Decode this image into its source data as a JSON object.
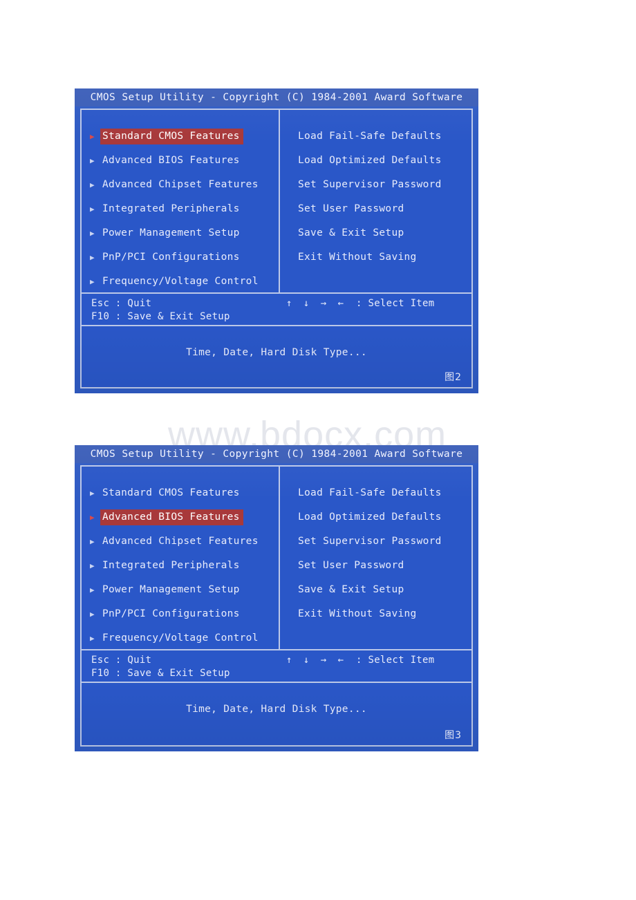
{
  "watermark": {
    "text": "www.bdocx.com"
  },
  "screens": [
    {
      "title": "CMOS Setup Utility - Copyright (C) 1984-2001 Award Software",
      "marker_icon": "right-triangle-icon",
      "left_menu": [
        {
          "label": "Standard CMOS Features",
          "selected": true
        },
        {
          "label": "Advanced BIOS Features",
          "selected": false
        },
        {
          "label": "Advanced Chipset Features",
          "selected": false
        },
        {
          "label": "Integrated Peripherals",
          "selected": false
        },
        {
          "label": "Power Management Setup",
          "selected": false
        },
        {
          "label": "PnP/PCI Configurations",
          "selected": false
        },
        {
          "label": "Frequency/Voltage Control",
          "selected": false
        }
      ],
      "right_menu": [
        {
          "label": "Load Fail-Safe Defaults"
        },
        {
          "label": "Load Optimized Defaults"
        },
        {
          "label": "Set Supervisor Password"
        },
        {
          "label": "Set User Password"
        },
        {
          "label": "Save & Exit Setup"
        },
        {
          "label": "Exit Without Saving"
        }
      ],
      "key_help": {
        "quit": "Esc : Quit",
        "save_exit": "F10 : Save & Exit Setup",
        "arrows": "↑ ↓ → ←",
        "select_item": ": Select Item"
      },
      "description": "Time, Date, Hard Disk Type...",
      "figure_caption": "图2",
      "colors": {
        "screen_blue": "#2a57c8",
        "title_blue": "#3a5db8",
        "frame_line": "#bcc8e8",
        "highlight_red": "#a8393b",
        "text_white": "#e8ecfb"
      }
    },
    {
      "title": "CMOS Setup Utility - Copyright (C) 1984-2001 Award Software",
      "marker_icon": "right-triangle-icon",
      "left_menu": [
        {
          "label": "Standard CMOS Features",
          "selected": false
        },
        {
          "label": "Advanced BIOS Features",
          "selected": true
        },
        {
          "label": "Advanced Chipset Features",
          "selected": false
        },
        {
          "label": "Integrated Peripherals",
          "selected": false
        },
        {
          "label": "Power Management Setup",
          "selected": false
        },
        {
          "label": "PnP/PCI Configurations",
          "selected": false
        },
        {
          "label": "Frequency/Voltage Control",
          "selected": false
        }
      ],
      "right_menu": [
        {
          "label": "Load Fail-Safe Defaults"
        },
        {
          "label": "Load Optimized Defaults"
        },
        {
          "label": "Set Supervisor Password"
        },
        {
          "label": "Set User Password"
        },
        {
          "label": "Save & Exit Setup"
        },
        {
          "label": "Exit Without Saving"
        }
      ],
      "key_help": {
        "quit": "Esc : Quit",
        "save_exit": "F10 : Save & Exit Setup",
        "arrows": "↑ ↓ → ←",
        "select_item": ": Select Item"
      },
      "description": "Time, Date, Hard Disk Type...",
      "figure_caption": "图3",
      "colors": {
        "screen_blue": "#2a57c8",
        "title_blue": "#3a5db8",
        "frame_line": "#bcc8e8",
        "highlight_red": "#a8393b",
        "text_white": "#e8ecfb"
      }
    }
  ]
}
